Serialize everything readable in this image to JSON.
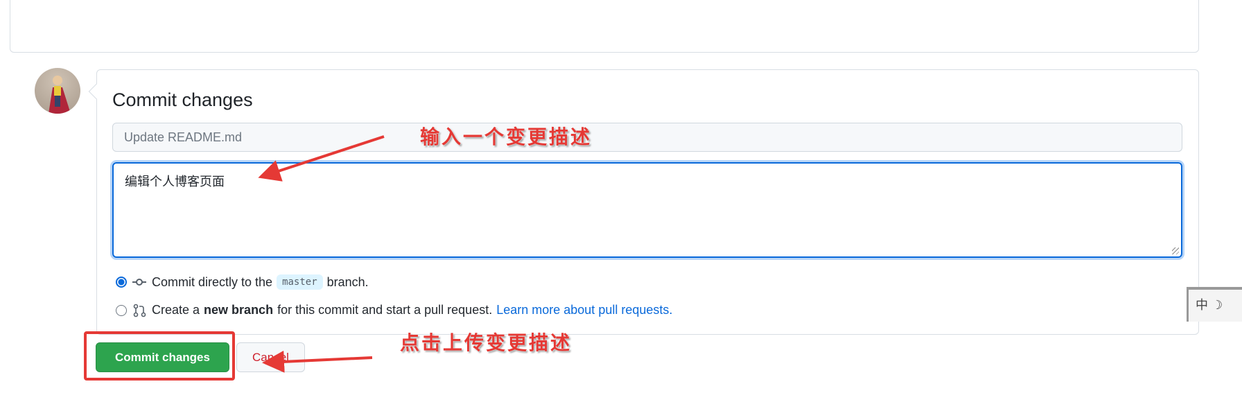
{
  "commit_form": {
    "title": "Commit changes",
    "summary_placeholder": "Update README.md",
    "description_value": "编辑个人博客页面",
    "option_direct": {
      "prefix": "Commit directly to the",
      "branch": "master",
      "suffix": "branch.",
      "selected": true
    },
    "option_new_branch": {
      "prefix": "Create a",
      "bold": "new branch",
      "suffix": "for this commit and start a pull request.",
      "link": "Learn more about pull requests.",
      "selected": false
    },
    "commit_button": "Commit changes",
    "cancel_button": "Cancel"
  },
  "annotations": {
    "input_note": "输入一个变更描述",
    "click_note": "点击上传变更描述"
  },
  "ime": {
    "label": "中"
  },
  "colors": {
    "primary": "#2da44e",
    "link": "#0969da",
    "annotation": "#e53935",
    "cancel": "#cf222e"
  }
}
